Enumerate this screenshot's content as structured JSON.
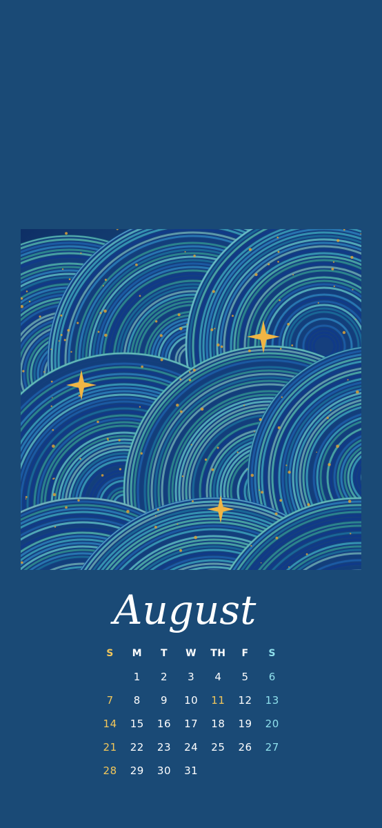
{
  "calendar": {
    "month": "August",
    "weekdays": [
      "S",
      "M",
      "T",
      "W",
      "TH",
      "F",
      "S"
    ],
    "first_weekday_index": 1,
    "days_in_month": 31,
    "colors": {
      "background": "#1a4a76",
      "sunday": "#f3c75a",
      "saturday": "#8fe0ec",
      "highlight": "#f3c75a",
      "default": "#ffffff"
    },
    "highlighted_days": [
      11
    ]
  },
  "artwork": {
    "subject": "abstract painting of blue and teal arcs with gold stars"
  }
}
